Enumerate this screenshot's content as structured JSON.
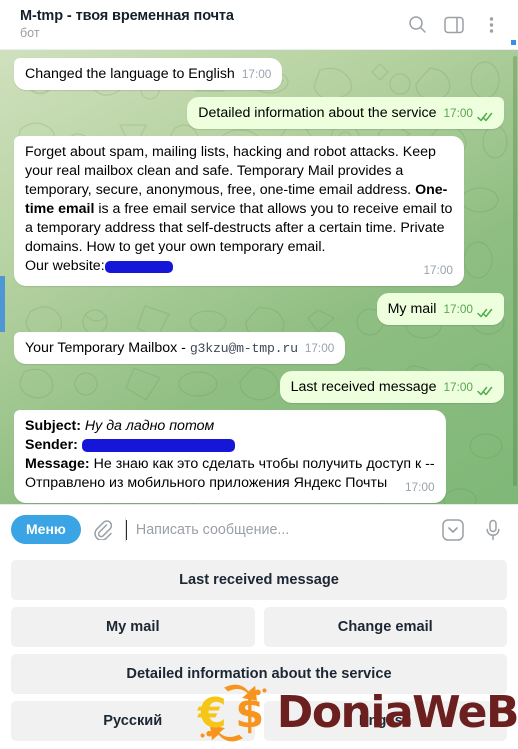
{
  "header": {
    "title": "M-tmp - твоя временная почта",
    "subtitle": "бот",
    "icons": {
      "search": "search-icon",
      "sidebar": "sidebar-panel-icon",
      "menu": "more-vertical-icon"
    }
  },
  "chat": {
    "messages": [
      {
        "id": "msg-language-changed",
        "direction": "in",
        "text": "Changed the language to English",
        "time": "17:00",
        "status": ""
      },
      {
        "id": "msg-detailed-info-request",
        "direction": "out",
        "text": "Detailed information about the service",
        "time": "17:00",
        "status": "read"
      },
      {
        "id": "msg-service-description",
        "direction": "in",
        "text_part1": "Forget about spam, mailing lists, hacking and robot attacks. Keep your real mailbox clean and safe. Temporary Mail provides a temporary, secure, anonymous, free, one-time email address. ",
        "bold": "One-time email",
        "text_part2": " is a free email service that allows you to receive email to a temporary address that self-destructs after a certain time. Private domains. How to get your own temporary email.\nOur website:",
        "redacted": true,
        "time": "17:00",
        "status": ""
      },
      {
        "id": "msg-my-mail-request",
        "direction": "out",
        "text": "My mail",
        "time": "17:00",
        "status": "read"
      },
      {
        "id": "msg-temporary-mailbox",
        "direction": "in",
        "label": "Your Temporary Mailbox - ",
        "email": "g3kzu@m-tmp.ru",
        "time": "17:00",
        "status": ""
      },
      {
        "id": "msg-last-received-request",
        "direction": "out",
        "text": "Last received message",
        "time": "17:00",
        "status": "read"
      },
      {
        "id": "msg-email-contents",
        "direction": "in",
        "subject_label": "Subject:",
        "subject_value": "Ну да ладно потом",
        "sender_label": "Sender:",
        "sender_value_redacted": true,
        "message_label": "Message:",
        "message_value": "Не знаю как это сделать чтобы получить доступ к --",
        "message_value_line2": "Отправлено из мобильного приложения Яндекс Почты",
        "time": "17:00",
        "status": ""
      }
    ]
  },
  "composer": {
    "menu_label": "Меню",
    "attach_icon": "paperclip-icon",
    "input_value": "",
    "input_placeholder": "Написать сообщение...",
    "emoji_icon": "chevron-down-box-icon",
    "voice_icon": "microphone-icon"
  },
  "keyboard": {
    "rows": [
      [
        {
          "label": "Last received message",
          "name": "kb-last-received-message"
        }
      ],
      [
        {
          "label": "My mail",
          "name": "kb-my-mail"
        },
        {
          "label": "Change email",
          "name": "kb-change-email"
        }
      ],
      [
        {
          "label": "Detailed information about the service",
          "name": "kb-detailed-information"
        }
      ],
      [
        {
          "label": "Русский",
          "name": "kb-russian"
        },
        {
          "label": "English",
          "name": "kb-english"
        }
      ]
    ]
  },
  "watermark": {
    "text": "DoniaWeB",
    "logo": "euro-dollar-exchange-icon"
  },
  "colors": {
    "accent_blue": "#3aa4e4",
    "outgoing_bubble": "#eeffdd",
    "incoming_bubble": "#ffffff",
    "tick_green": "#5aa554",
    "redaction_blue": "#1516d8",
    "watermark_maroon": "#6b1f1f",
    "keyboard_button": "#f1f1f1"
  }
}
